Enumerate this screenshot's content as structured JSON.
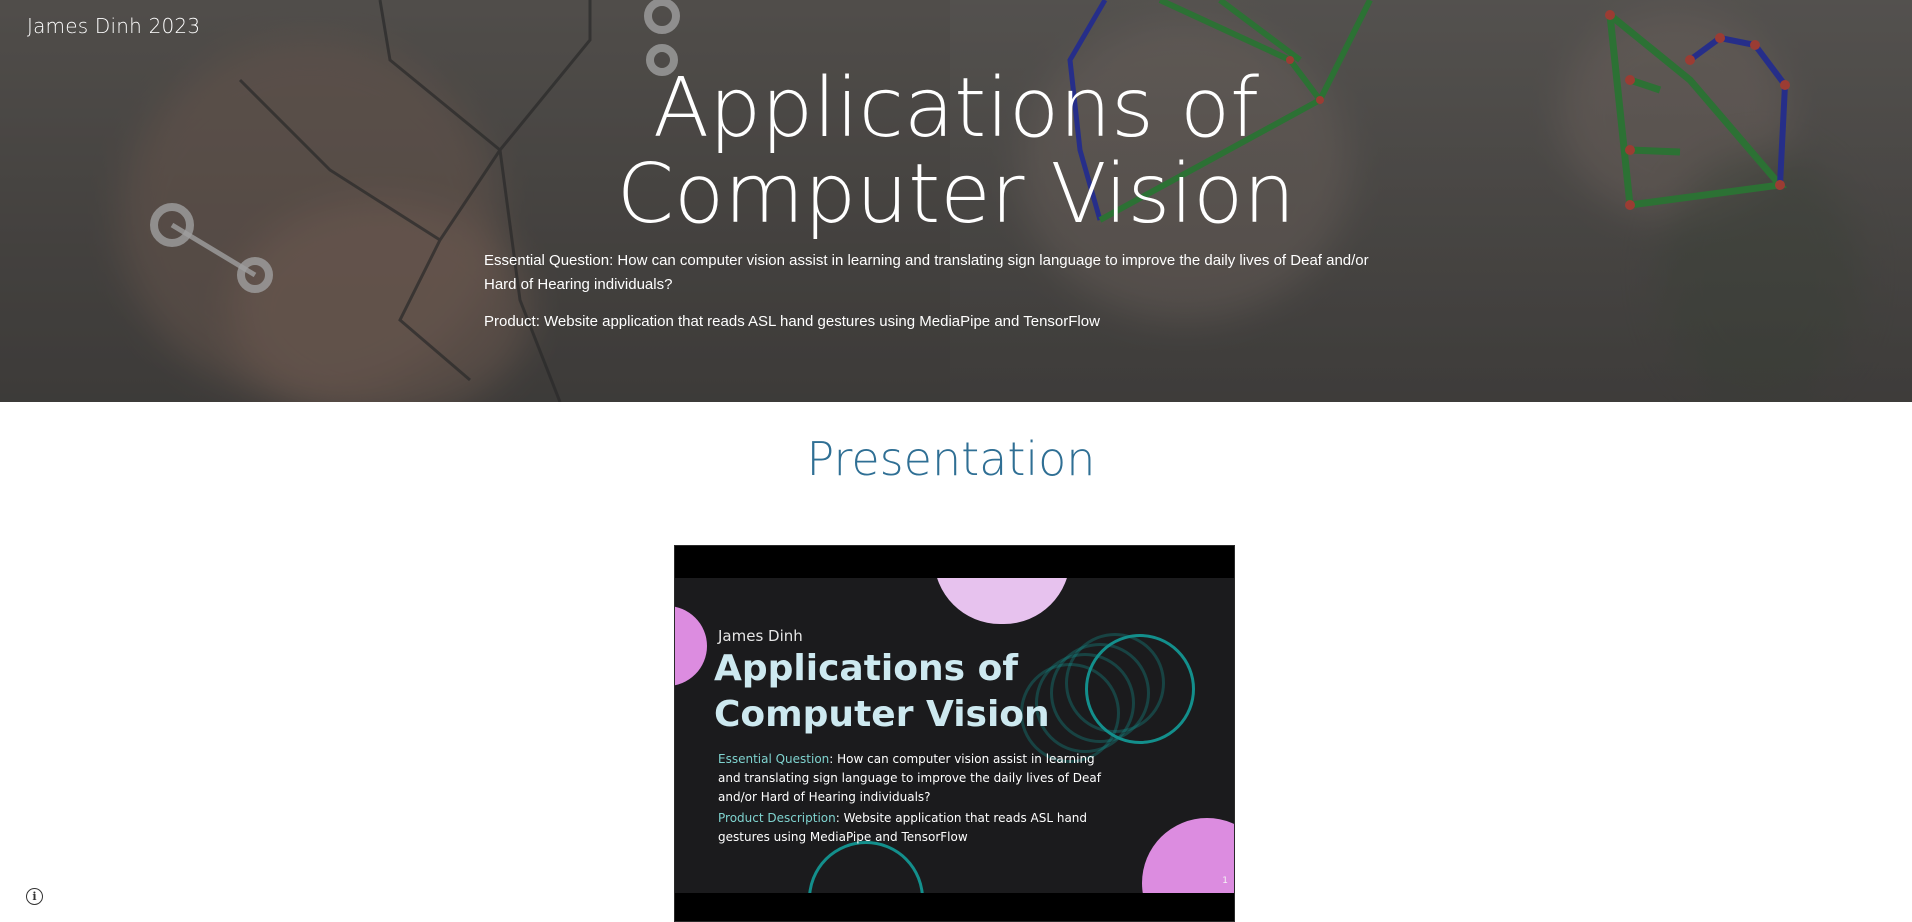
{
  "header": {
    "site_title": "James Dinh 2023"
  },
  "hero": {
    "title_line1": "Applications of",
    "title_line2": "Computer Vision",
    "essential_question": "Essential Question: How can computer vision assist in learning and translating sign language to improve the daily lives of Deaf and/or Hard of Hearing individuals?",
    "product": "Product: Website application that reads ASL hand gestures using MediaPipe and TensorFlow"
  },
  "section": {
    "title": "Presentation"
  },
  "slide": {
    "author": "James Dinh",
    "title_line1": "Applications of",
    "title_line2": "Computer Vision",
    "eq_label": "Essential Question",
    "eq_text": ": How can computer vision assist in learning and translating sign language to improve the daily lives of Deaf and/or Hard of Hearing individuals?",
    "prod_label": "Product Description",
    "prod_text": ": Website application that reads ASL hand gestures using MediaPipe and TensorFlow",
    "page_number": "1"
  },
  "footer": {
    "info_icon": "info-icon"
  },
  "colors": {
    "section_title": "#2f6f94",
    "slide_background": "#1b1b1d",
    "slide_accent_pink": "#dc8ce0",
    "slide_accent_teal": "#138f8c",
    "slide_title": "#cde9f0"
  }
}
